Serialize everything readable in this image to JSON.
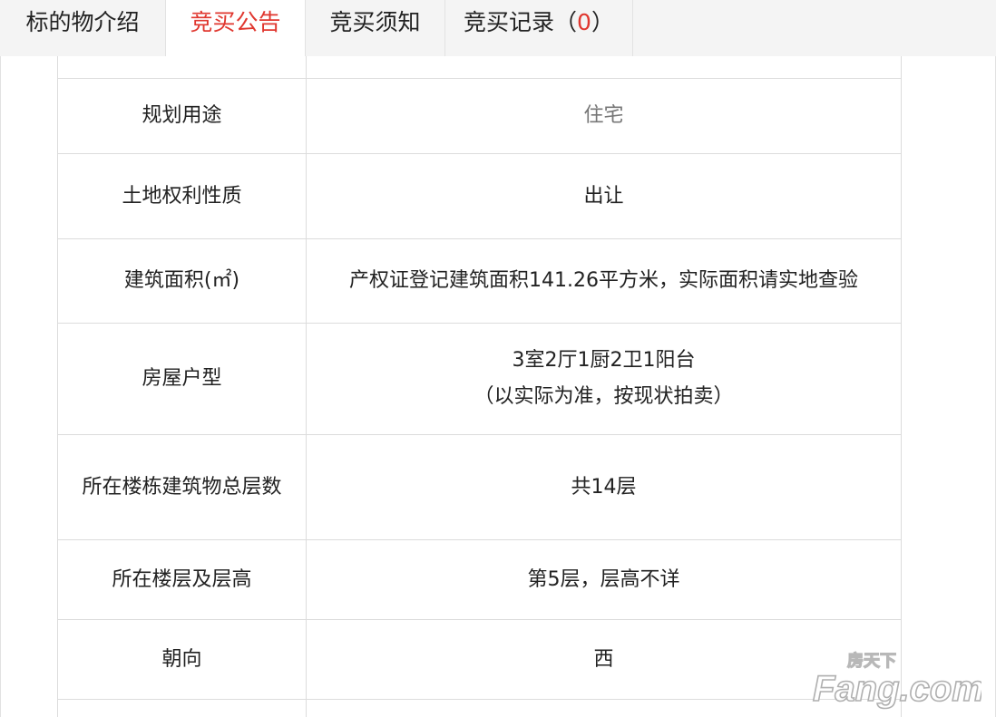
{
  "tabs": [
    {
      "label": "标的物介绍",
      "active": false
    },
    {
      "label": "竞买公告",
      "active": true
    },
    {
      "label": "竞买须知",
      "active": false
    },
    {
      "label": "竞买记录（",
      "count": "0",
      "suffix": "）",
      "active": false
    }
  ],
  "rows": [
    {
      "label": "规划用途",
      "value": "住宅"
    },
    {
      "label": "土地权利性质",
      "value": "出让"
    },
    {
      "label": "建筑面积(㎡)",
      "value": "产权证登记建筑面积141.26平方米，实际面积请实地查验"
    },
    {
      "label": "房屋户型",
      "value_line1": "3室2厅1厨2卫1阳台",
      "value_line2": "（以实际为准，按现状拍卖）"
    },
    {
      "label": "所在楼栋建筑物总层数",
      "value": "共14层"
    },
    {
      "label": "所在楼层及层高",
      "value": "第5层，层高不详"
    },
    {
      "label": "朝向",
      "value": "西"
    }
  ],
  "watermark": {
    "top": "房天下",
    "bottom": "Fang.com"
  },
  "colors": {
    "accent": "#e0372f",
    "tab_bg": "#f4f4f4",
    "border": "#dcdcdc",
    "muted_text": "#777777"
  }
}
